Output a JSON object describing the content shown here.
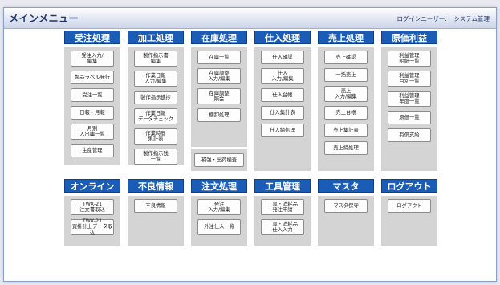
{
  "app": {
    "title": "メインメニュー",
    "login_label": "ログインユーザー:",
    "login_user": "システム管理"
  },
  "top_sections": [
    {
      "title": "受注処理",
      "buttons": [
        "受注入力/\n編集",
        "製品ラベル発行",
        "受注一覧",
        "日報・月報",
        "月別\n入出庫一覧",
        "生産管理"
      ]
    },
    {
      "title": "加工処理",
      "buttons": [
        "製作指示書\n編集",
        "作業日報\n入力/編集",
        "製作指示進捗",
        "作業日報\nデータチェック",
        "作業時間\n集計表",
        "製作指示残\n一覧"
      ]
    },
    {
      "title": "在庫処理",
      "buttons": [
        "在庫一覧",
        "在庫調整\n入力/編集",
        "在庫調整\n照会",
        "棚卸処理"
      ],
      "extra_button": "補強・出荷検査"
    },
    {
      "title": "仕入処理",
      "buttons": [
        "仕入確認",
        "仕入\n入力/編集",
        "仕入台帳",
        "仕入集計表",
        "仕入締処理"
      ]
    },
    {
      "title": "売上処理",
      "buttons": [
        "売上確認",
        "一括売上",
        "売上\n入力/編集",
        "売上台帳",
        "売上集計表",
        "売上締処理"
      ]
    },
    {
      "title": "原価利益",
      "buttons": [
        "利益管理\n明細一覧",
        "利益管理\n月別一覧",
        "利益管理\n年度一覧",
        "原価一覧",
        "有償支給"
      ]
    }
  ],
  "bottom_sections": [
    {
      "title": "オンライン",
      "buttons": [
        "TWX-21\n注文書取込",
        "TWX-21\n買掛計上データ取込"
      ]
    },
    {
      "title": "不良情報",
      "buttons": [
        "不良情報"
      ]
    },
    {
      "title": "注文処理",
      "buttons": [
        "発注\n入力/編集",
        "外注仕入一覧"
      ]
    },
    {
      "title": "工具管理",
      "buttons": [
        "工具・消耗品\n発注申請",
        "工具・消耗品\n仕入入力"
      ]
    },
    {
      "title": "マスタ",
      "buttons": [
        "マスタ保守"
      ]
    },
    {
      "title": "ログアウト",
      "buttons": [
        "ログアウト"
      ]
    }
  ],
  "colors": {
    "header_blue": "#1a5cb6",
    "panel_gray": "#d4d4d4",
    "title_text": "#20376a"
  }
}
